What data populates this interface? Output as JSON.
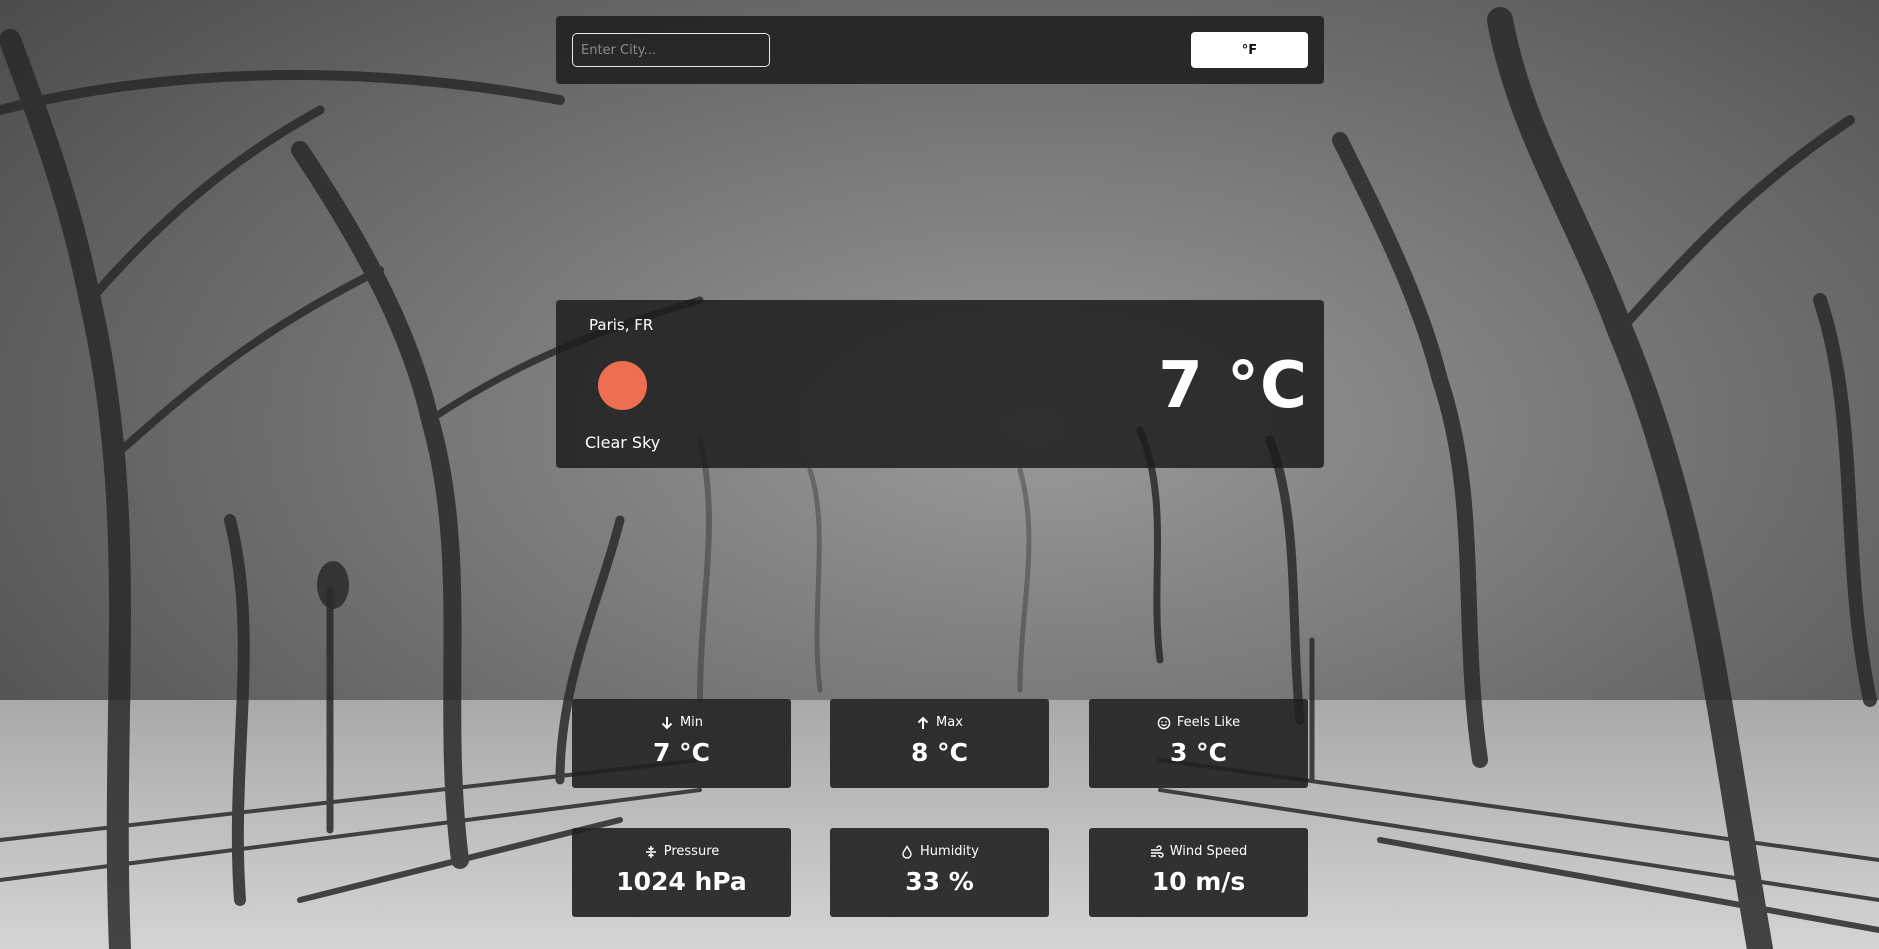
{
  "search": {
    "placeholder": "Enter City..."
  },
  "unit_toggle": {
    "label": "°F"
  },
  "current": {
    "location": "Paris, FR",
    "condition": "Clear Sky",
    "temperature": "7 °C",
    "icon": "sun-icon",
    "icon_color": "#ee6e51"
  },
  "stats": [
    {
      "label": "Min",
      "value": "7 °C",
      "icon": "arrow-down-icon"
    },
    {
      "label": "Max",
      "value": "8 °C",
      "icon": "arrow-up-icon"
    },
    {
      "label": "Feels Like",
      "value": "3 °C",
      "icon": "smile-icon"
    },
    {
      "label": "Pressure",
      "value": "1024 hPa",
      "icon": "compress-icon"
    },
    {
      "label": "Humidity",
      "value": "33 %",
      "icon": "droplet-icon"
    },
    {
      "label": "Wind Speed",
      "value": "10 m/s",
      "icon": "wind-icon"
    }
  ]
}
